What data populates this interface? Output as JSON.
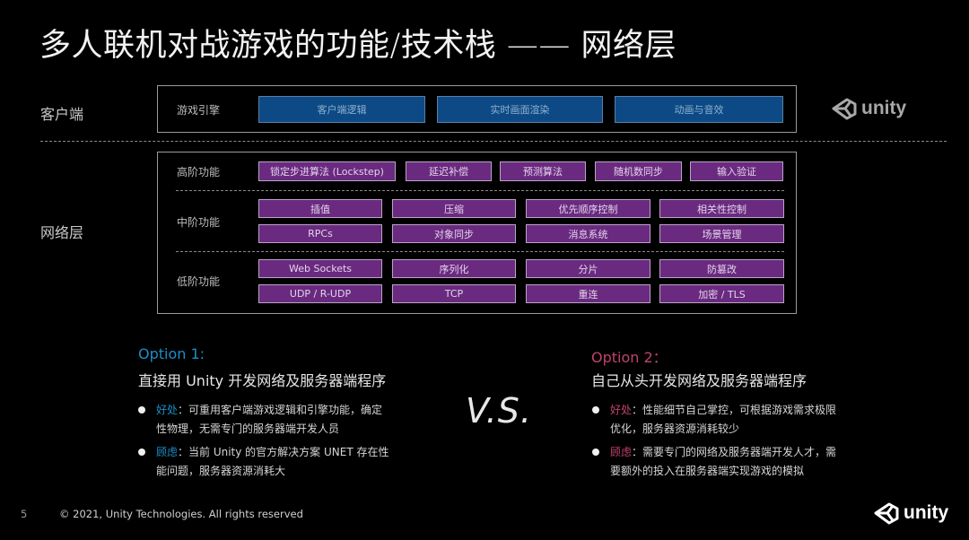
{
  "slide": {
    "title": "多人联机对战游戏的功能/技术栈 —— 网络层",
    "page_number": "5",
    "copyright": "©  2021, Unity Technologies. All rights reserved",
    "logo_text": "unity"
  },
  "colors": {
    "client_box": "#0d4a85",
    "network_box": "#6a2a80",
    "option1_accent": "#1a8fc9",
    "option2_accent": "#c0436b"
  },
  "client": {
    "row_label": "客户端",
    "sub_label": "游戏引擎",
    "boxes": [
      "客户端逻辑",
      "实时画面渲染",
      "动画与音效"
    ]
  },
  "network": {
    "row_label": "网络层",
    "high": {
      "label": "高阶功能",
      "boxes": [
        "锁定步进算法 (Lockstep)",
        "延迟补偿",
        "预测算法",
        "随机数同步",
        "输入验证"
      ]
    },
    "mid": {
      "label": "中阶功能",
      "row1": [
        "插值",
        "压缩",
        "优先顺序控制",
        "相关性控制"
      ],
      "row2": [
        "RPCs",
        "对象同步",
        "消息系统",
        "场景管理"
      ]
    },
    "low": {
      "label": "低阶功能",
      "row1": [
        "Web Sockets",
        "序列化",
        "分片",
        "防篡改"
      ],
      "row2": [
        "UDP / R-UDP",
        "TCP",
        "重连",
        "加密 / TLS"
      ]
    }
  },
  "vs": "V.S.",
  "option1": {
    "heading": "Option 1:",
    "subtitle": "直接用 Unity 开发网络及服务器端程序",
    "bullets": [
      {
        "key": "好处",
        "text": "：可重用客户端游戏逻辑和引擎功能，确定性物理，无需专门的服务器端开发人员"
      },
      {
        "key": "顾虑",
        "text": "：当前 Unity 的官方解决方案 UNET 存在性能问题，服务器资源消耗大"
      }
    ]
  },
  "option2": {
    "heading": "Option 2：",
    "subtitle": "自己从头开发网络及服务器端程序",
    "bullets": [
      {
        "key": "好处",
        "text": "：性能细节自己掌控，可根据游戏需求极限优化，服务器资源消耗较少"
      },
      {
        "key": "顾虑",
        "text": "：需要专门的网络及服务器端开发人才，需要额外的投入在服务器端实现游戏的模拟"
      }
    ]
  }
}
